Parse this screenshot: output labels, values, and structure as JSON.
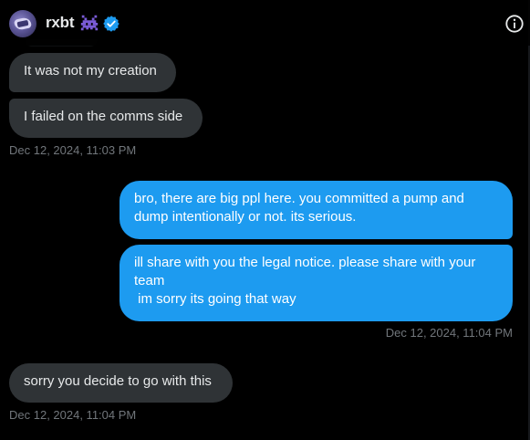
{
  "header": {
    "name": "rxbt",
    "icons": [
      "alien-emoji-icon",
      "verified-badge-icon",
      "info-icon"
    ],
    "verified_color": "#1d9bf0"
  },
  "messages": [
    {
      "direction": "incoming",
      "text": "It was not my creation"
    },
    {
      "direction": "incoming",
      "text": "I failed on the comms side"
    },
    {
      "direction": "timestamp",
      "text": "Dec 12, 2024, 11:03 PM"
    },
    {
      "direction": "outgoing",
      "text": "bro, there are big ppl here. you committed a pump and dump intentionally or not. its serious."
    },
    {
      "direction": "outgoing",
      "text": "ill share with you the legal notice. please share with your team\n im sorry its going that way"
    },
    {
      "direction": "timestamp",
      "text": "Dec 12, 2024, 11:04 PM"
    },
    {
      "direction": "incoming",
      "text": "sorry you decide to go with this"
    },
    {
      "direction": "timestamp",
      "text": "Dec 12, 2024, 11:04 PM"
    }
  ],
  "colors": {
    "background": "#000000",
    "incoming_bubble": "#2f3336",
    "outgoing_bubble": "#1d9bf0",
    "timestamp": "#71767b"
  }
}
